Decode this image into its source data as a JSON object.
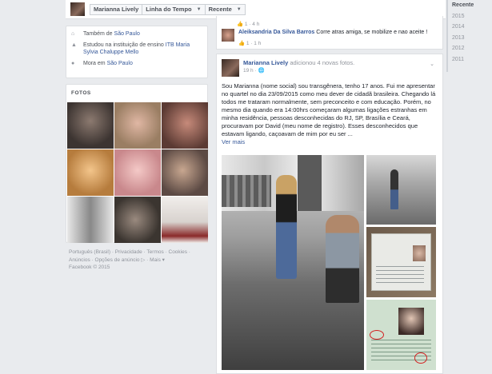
{
  "topbar": {
    "name": "Marianna Lively",
    "timeline": "Linha do Tempo",
    "recent": "Recente"
  },
  "years": [
    "Recente",
    "2015",
    "2014",
    "2013",
    "2012",
    "2011"
  ],
  "intro": {
    "lives_prefix": "Também de ",
    "lives_city": "São Paulo",
    "studied_prefix": "Estudou na instituição de ensino ",
    "studied_school": "ITB Maria Sylvia Chaluppe Mello",
    "home_prefix": "Mora em ",
    "home_city": "São Paulo"
  },
  "photos": {
    "header": "FOTOS"
  },
  "footer": {
    "line1": "Português (Brasil) · Privacidade · Termos · Cookies ·",
    "line2": "Anúncios · Opções de anúncio ▷ · Mais ▾",
    "line3": "Facebook © 2015"
  },
  "comment_card": {
    "top_likes": "1 · 4 h",
    "author": "Aleiksandria Da Silva Barros",
    "text": " Corre atras amiga, se mobilize e nao aceite !",
    "bottom_likes": "1 · 1 h"
  },
  "post": {
    "author": "Marianna Lively",
    "action": " adicionou 4 novas fotos.",
    "time": "19 h · ",
    "globe": "🌐",
    "body": "Sou Marianna (nome social) sou transgênera, tenho 17 anos. Fui me apresentar no quartel no dia 23/09/2015 como meu dever de cidadã brasileira. Chegando lá todos me trataram normalmente, sem preconceito e com educação. Porém, no mesmo dia quando era 14:00hrs começaram algumas ligações estranhas em minha residência, pessoas desconhecidas do RJ, SP, Brasília e Ceará, procuravam por David (meu nome de registro). Esses desconhecidos que estavam ligando, caçoavam de mim por eu ser ...",
    "see_more": "Ver mais"
  },
  "icons": {
    "city": "home-icon",
    "school": "graduation-cap-icon",
    "location": "location-pin-icon",
    "like": "thumbs-up-icon"
  }
}
